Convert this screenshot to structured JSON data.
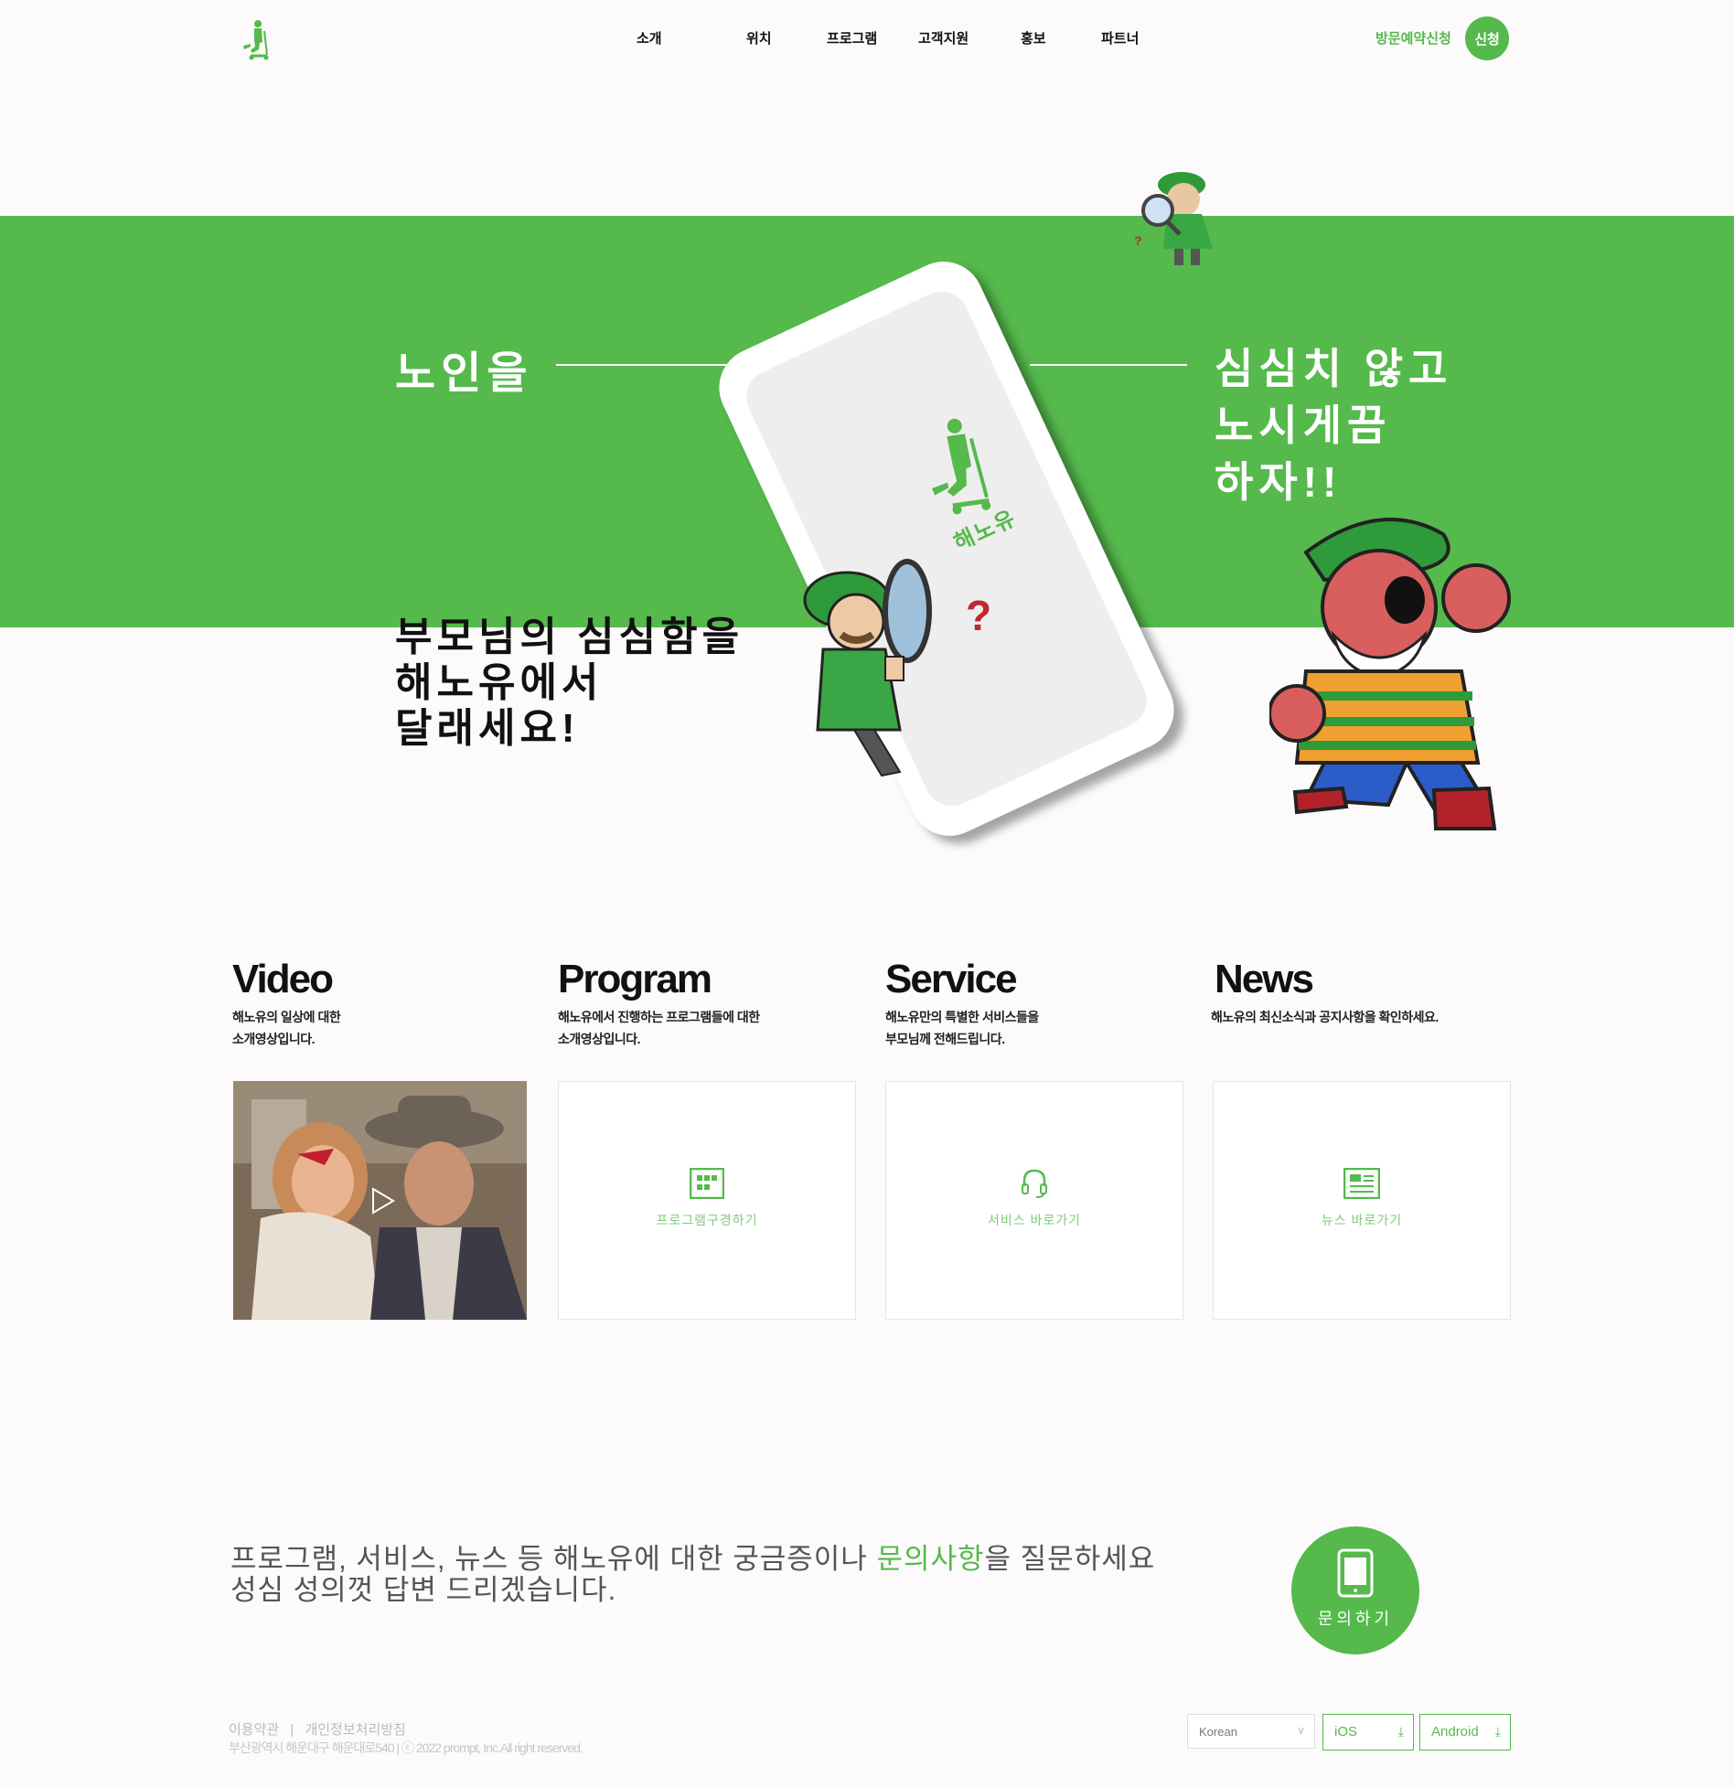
{
  "header": {
    "nav": [
      {
        "label": "소개"
      },
      {
        "label": "위치"
      },
      {
        "label": "프로그램"
      },
      {
        "label": "고객지원"
      },
      {
        "label": "홍보"
      },
      {
        "label": "파트너"
      }
    ],
    "reserve_text": "방문예약신청",
    "reserve_button": "신청"
  },
  "hero": {
    "left_title": "노인을",
    "right_title": [
      "심심치 않고",
      "노시게끔",
      "하자!!"
    ],
    "subtitle": [
      "부모님의 심심함을",
      "해노유에서",
      "달래세요!"
    ],
    "phone_label": "해노유",
    "question_mark": "?"
  },
  "sections": [
    {
      "title": "Video",
      "desc": [
        "해노유의 일상에 대한",
        "소개영상입니다."
      ]
    },
    {
      "title": "Program",
      "desc": [
        "해노유에서 진행하는 프로그램들에 대한",
        "소개영상입니다."
      ],
      "link": "프로그램구경하기",
      "icon": "grid-icon"
    },
    {
      "title": "Service",
      "desc": [
        "해노유만의 특별한 서비스들을",
        "부모님께 전해드립니다."
      ],
      "link": "서비스 바로가기",
      "icon": "headset-icon"
    },
    {
      "title": "News",
      "desc": [
        "해노유의 최신소식과 공지사항을 확인하세요."
      ],
      "link": "뉴스 바로가기",
      "icon": "newspaper-icon"
    }
  ],
  "inquiry": {
    "line1_before": "프로그램, 서비스, 뉴스 등 해노유에 대한 궁금증이나 ",
    "line1_highlight": "문의사항",
    "line1_after": "을 질문하세요",
    "line2": "성심 성의껏 답변 드리겠습니다.",
    "button": "문의하기"
  },
  "footer": {
    "terms": "이용약관",
    "separator": "|",
    "privacy": "개인정보처리방침",
    "address": "부산광역시 해운대구 해운대로540 | ⓒ 2022 prompt, Inc.All right reserved.",
    "language": "Korean",
    "ios": "iOS",
    "android": "Android"
  },
  "colors": {
    "brand": "#55b94c",
    "background": "#fcfafa"
  }
}
